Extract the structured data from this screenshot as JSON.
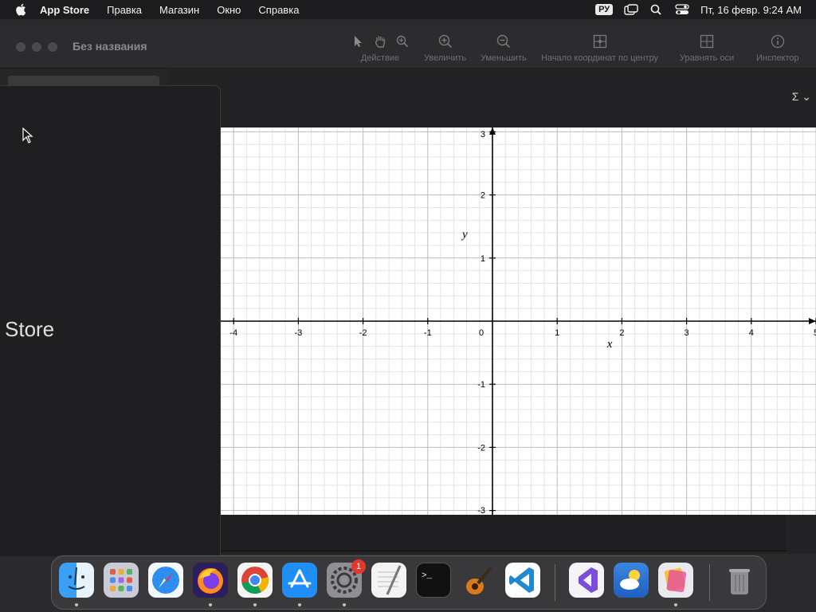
{
  "menubar": {
    "app_name": "App Store",
    "items": [
      "Правка",
      "Магазин",
      "Окно",
      "Справка"
    ],
    "lang": "РУ",
    "datetime": "Пт, 16 февр. 9:24 AM"
  },
  "window": {
    "title": "Без названия",
    "toolbar": {
      "action_label": "Действие",
      "zoom_in_label": "Увеличить",
      "zoom_out_label": "Уменьшить",
      "center_origin_label": "Начало координат по центру",
      "equalize_axes_label": "Уравнять оси",
      "inspector_label": "Инспектор"
    },
    "sum_button": "Σ ⌄"
  },
  "graph": {
    "xlabel": "x",
    "ylabel": "y",
    "x_ticks": [
      "-4",
      "-3",
      "-2",
      "-1",
      "0",
      "1",
      "2",
      "3",
      "4",
      "5"
    ],
    "y_ticks": [
      "3",
      "2",
      "1",
      "-1",
      "-2",
      "-3"
    ],
    "xlim": [
      -4.2,
      5
    ],
    "ylim": [
      -3,
      3
    ]
  },
  "panel": {
    "text": "Store"
  },
  "dock": {
    "items": [
      "finder",
      "launchpad",
      "safari",
      "firefox",
      "chrome",
      "app-store",
      "system-settings",
      "textedit",
      "terminal",
      "garageband",
      "vscode",
      "visual-studio",
      "weather",
      "pixelmator",
      "trash"
    ],
    "settings_badge": "1"
  },
  "colors": {
    "grid_major": "#bdbdbd",
    "grid_minor": "#e4e4e4",
    "axis": "#000000"
  }
}
